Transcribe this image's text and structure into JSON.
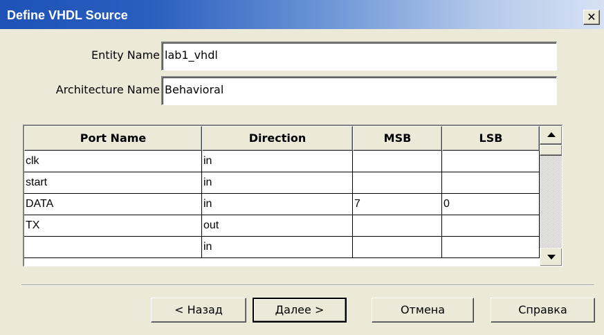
{
  "window": {
    "title": "Define VHDL Source",
    "close_glyph": "✕",
    "close_icon": "close-icon"
  },
  "form": {
    "entity_label": "Entity Name",
    "entity_value": "lab1_vhdl",
    "arch_label": "Architecture Name",
    "arch_value": "Behavioral"
  },
  "table": {
    "headers": [
      "Port Name",
      "Direction",
      "MSB",
      "LSB"
    ],
    "rows": [
      [
        "clk",
        "in",
        "",
        ""
      ],
      [
        "start",
        "in",
        "",
        ""
      ],
      [
        "DATA",
        "in",
        "7",
        "0"
      ],
      [
        "TX",
        "out",
        "",
        ""
      ],
      [
        "",
        "in",
        "",
        ""
      ]
    ],
    "scroll_up_icon": "scroll-up-icon",
    "scroll_down_icon": "scroll-down-icon"
  },
  "buttons": {
    "back": "< Назад",
    "next": "Далее >",
    "cancel": "Отмена",
    "help": "Справка"
  },
  "colors": {
    "face": "#ece9d8",
    "title_gradient_start": "#1e52b6",
    "title_gradient_end": "#d6e1f3",
    "title_text": "#ffffff"
  }
}
